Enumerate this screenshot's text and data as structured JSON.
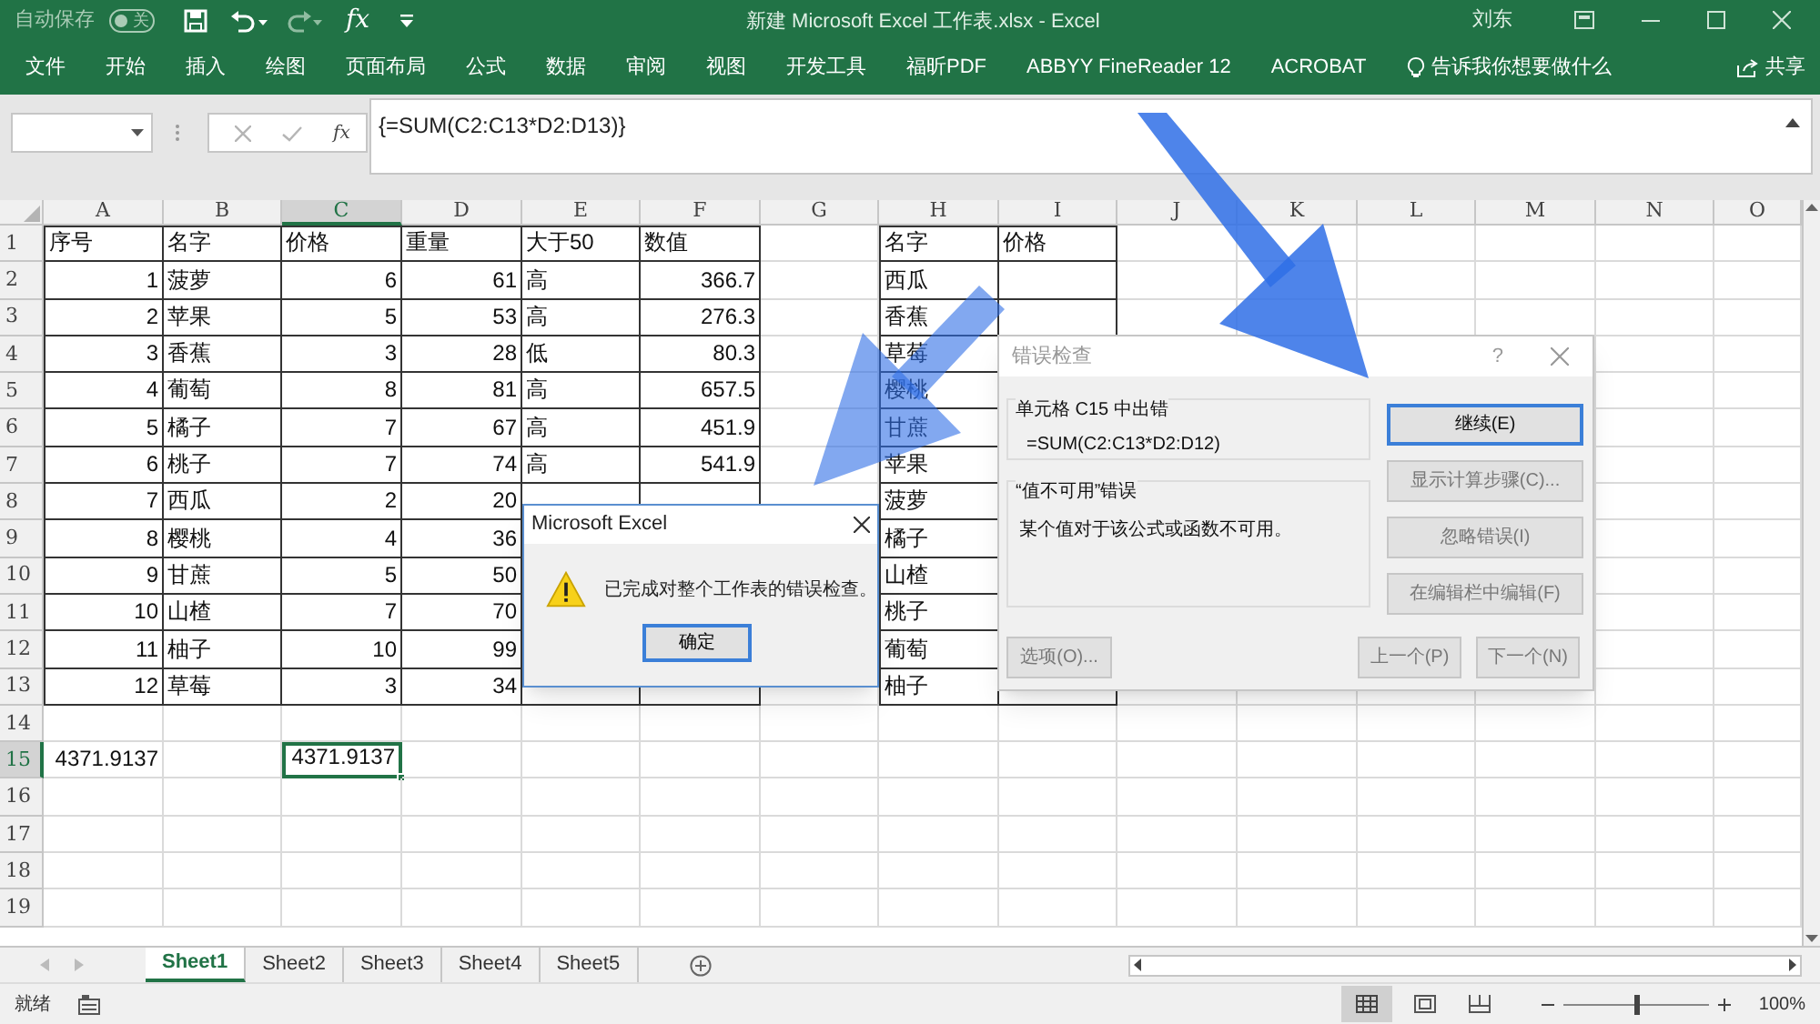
{
  "title_bar": {
    "autosave_label": "自动保存",
    "autosave_switch": "关",
    "autosave_on": false,
    "fx": "fx",
    "title": "新建 Microsoft Excel 工作表.xlsx  -  Excel",
    "user": "刘东"
  },
  "ribbon_tabs": [
    "文件",
    "开始",
    "插入",
    "绘图",
    "页面布局",
    "公式",
    "数据",
    "审阅",
    "视图",
    "开发工具",
    "福昕PDF",
    "ABBYY FineReader 12",
    "ACROBAT"
  ],
  "tell_me": "告诉我你想要做什么",
  "share": "共享",
  "formula_bar": {
    "fx": "fx",
    "formula": "{=SUM(C2:C13*D2:D13)}"
  },
  "columns": [
    {
      "label": "A",
      "selected": false
    },
    {
      "label": "B",
      "selected": false
    },
    {
      "label": "C",
      "selected": true
    },
    {
      "label": "D",
      "selected": false
    },
    {
      "label": "E",
      "selected": false
    },
    {
      "label": "F",
      "selected": false
    },
    {
      "label": "G",
      "selected": false
    },
    {
      "label": "H",
      "selected": false
    },
    {
      "label": "I",
      "selected": false
    },
    {
      "label": "J",
      "selected": false
    },
    {
      "label": "K",
      "selected": false
    },
    {
      "label": "L",
      "selected": false
    },
    {
      "label": "M",
      "selected": false
    },
    {
      "label": "N",
      "selected": false
    },
    {
      "label": "O",
      "selected": false
    }
  ],
  "rows": [
    {
      "label": "1",
      "selected": false,
      "cells": {
        "A": {
          "text": "序号",
          "kind": "text",
          "selected": false
        },
        "B": {
          "text": "名字",
          "kind": "text",
          "selected": false
        },
        "C": {
          "text": "价格",
          "kind": "text",
          "selected": false
        },
        "D": {
          "text": "重量",
          "kind": "text",
          "selected": false
        },
        "E": {
          "text": "大于50",
          "kind": "text",
          "selected": false
        },
        "F": {
          "text": "数值",
          "kind": "text",
          "selected": false
        },
        "H": {
          "text": "名字",
          "kind": "text",
          "selected": false
        },
        "I": {
          "text": "价格",
          "kind": "text",
          "selected": false
        }
      }
    },
    {
      "label": "2",
      "selected": false,
      "cells": {
        "A": {
          "text": "1",
          "kind": "number",
          "selected": false
        },
        "B": {
          "text": "菠萝",
          "kind": "text",
          "selected": false
        },
        "C": {
          "text": "6",
          "kind": "number",
          "selected": false
        },
        "D": {
          "text": "61",
          "kind": "number",
          "selected": false
        },
        "E": {
          "text": "高",
          "kind": "text",
          "selected": false
        },
        "F": {
          "text": "366.7",
          "kind": "number",
          "selected": false
        },
        "H": {
          "text": "西瓜",
          "kind": "text",
          "selected": false
        }
      }
    },
    {
      "label": "3",
      "selected": false,
      "cells": {
        "A": {
          "text": "2",
          "kind": "number",
          "selected": false
        },
        "B": {
          "text": "苹果",
          "kind": "text",
          "selected": false
        },
        "C": {
          "text": "5",
          "kind": "number",
          "selected": false
        },
        "D": {
          "text": "53",
          "kind": "number",
          "selected": false
        },
        "E": {
          "text": "高",
          "kind": "text",
          "selected": false
        },
        "F": {
          "text": "276.3",
          "kind": "number",
          "selected": false
        },
        "H": {
          "text": "香蕉",
          "kind": "text",
          "selected": false
        }
      }
    },
    {
      "label": "4",
      "selected": false,
      "cells": {
        "A": {
          "text": "3",
          "kind": "number",
          "selected": false
        },
        "B": {
          "text": "香蕉",
          "kind": "text",
          "selected": false
        },
        "C": {
          "text": "3",
          "kind": "number",
          "selected": false
        },
        "D": {
          "text": "28",
          "kind": "number",
          "selected": false
        },
        "E": {
          "text": "低",
          "kind": "text",
          "selected": false
        },
        "F": {
          "text": "80.3",
          "kind": "number",
          "selected": false
        },
        "H": {
          "text": "草莓",
          "kind": "text",
          "selected": false
        }
      }
    },
    {
      "label": "5",
      "selected": false,
      "cells": {
        "A": {
          "text": "4",
          "kind": "number",
          "selected": false
        },
        "B": {
          "text": "葡萄",
          "kind": "text",
          "selected": false
        },
        "C": {
          "text": "8",
          "kind": "number",
          "selected": false
        },
        "D": {
          "text": "81",
          "kind": "number",
          "selected": false
        },
        "E": {
          "text": "高",
          "kind": "text",
          "selected": false
        },
        "F": {
          "text": "657.5",
          "kind": "number",
          "selected": false
        },
        "H": {
          "text": "樱桃",
          "kind": "text",
          "selected": false
        }
      }
    },
    {
      "label": "6",
      "selected": false,
      "cells": {
        "A": {
          "text": "5",
          "kind": "number",
          "selected": false
        },
        "B": {
          "text": "橘子",
          "kind": "text",
          "selected": false
        },
        "C": {
          "text": "7",
          "kind": "number",
          "selected": false
        },
        "D": {
          "text": "67",
          "kind": "number",
          "selected": false
        },
        "E": {
          "text": "高",
          "kind": "text",
          "selected": false
        },
        "F": {
          "text": "451.9",
          "kind": "number",
          "selected": false
        },
        "H": {
          "text": "甘蔗",
          "kind": "text",
          "selected": false
        }
      }
    },
    {
      "label": "7",
      "selected": false,
      "cells": {
        "A": {
          "text": "6",
          "kind": "number",
          "selected": false
        },
        "B": {
          "text": "桃子",
          "kind": "text",
          "selected": false
        },
        "C": {
          "text": "7",
          "kind": "number",
          "selected": false
        },
        "D": {
          "text": "74",
          "kind": "number",
          "selected": false
        },
        "E": {
          "text": "高",
          "kind": "text",
          "selected": false
        },
        "F": {
          "text": "541.9",
          "kind": "number",
          "selected": false
        },
        "H": {
          "text": "苹果",
          "kind": "text",
          "selected": false
        }
      }
    },
    {
      "label": "8",
      "selected": false,
      "cells": {
        "A": {
          "text": "7",
          "kind": "number",
          "selected": false
        },
        "B": {
          "text": "西瓜",
          "kind": "text",
          "selected": false
        },
        "C": {
          "text": "2",
          "kind": "number",
          "selected": false
        },
        "D": {
          "text": "20",
          "kind": "number",
          "selected": false
        },
        "H": {
          "text": "菠萝",
          "kind": "text",
          "selected": false
        }
      }
    },
    {
      "label": "9",
      "selected": false,
      "cells": {
        "A": {
          "text": "8",
          "kind": "number",
          "selected": false
        },
        "B": {
          "text": "樱桃",
          "kind": "text",
          "selected": false
        },
        "C": {
          "text": "4",
          "kind": "number",
          "selected": false
        },
        "D": {
          "text": "36",
          "kind": "number",
          "selected": false
        },
        "H": {
          "text": "橘子",
          "kind": "text",
          "selected": false
        }
      }
    },
    {
      "label": "10",
      "selected": false,
      "cells": {
        "A": {
          "text": "9",
          "kind": "number",
          "selected": false
        },
        "B": {
          "text": "甘蔗",
          "kind": "text",
          "selected": false
        },
        "C": {
          "text": "5",
          "kind": "number",
          "selected": false
        },
        "D": {
          "text": "50",
          "kind": "number",
          "selected": false
        },
        "H": {
          "text": "山楂",
          "kind": "text",
          "selected": false
        }
      }
    },
    {
      "label": "11",
      "selected": false,
      "cells": {
        "A": {
          "text": "10",
          "kind": "number",
          "selected": false
        },
        "B": {
          "text": "山楂",
          "kind": "text",
          "selected": false
        },
        "C": {
          "text": "7",
          "kind": "number",
          "selected": false
        },
        "D": {
          "text": "70",
          "kind": "number",
          "selected": false
        },
        "H": {
          "text": "桃子",
          "kind": "text",
          "selected": false
        }
      }
    },
    {
      "label": "12",
      "selected": false,
      "cells": {
        "A": {
          "text": "11",
          "kind": "number",
          "selected": false
        },
        "B": {
          "text": "柚子",
          "kind": "text",
          "selected": false
        },
        "C": {
          "text": "10",
          "kind": "number",
          "selected": false
        },
        "D": {
          "text": "99",
          "kind": "number",
          "selected": false
        },
        "H": {
          "text": "葡萄",
          "kind": "text",
          "selected": false
        }
      }
    },
    {
      "label": "13",
      "selected": false,
      "cells": {
        "A": {
          "text": "12",
          "kind": "number",
          "selected": false
        },
        "B": {
          "text": "草莓",
          "kind": "text",
          "selected": false
        },
        "C": {
          "text": "3",
          "kind": "number",
          "selected": false
        },
        "D": {
          "text": "34",
          "kind": "number",
          "selected": false
        },
        "H": {
          "text": "柚子",
          "kind": "text",
          "selected": false
        }
      }
    },
    {
      "label": "14",
      "selected": false
    },
    {
      "label": "15",
      "selected": true,
      "cells": {
        "A": {
          "text": "4371.9137",
          "kind": "number",
          "selected": false
        },
        "C": {
          "text": "4371.9137",
          "kind": "number",
          "selected": true
        }
      }
    },
    {
      "label": "16",
      "selected": false
    },
    {
      "label": "17",
      "selected": false
    },
    {
      "label": "18",
      "selected": false
    },
    {
      "label": "19",
      "selected": false
    }
  ],
  "sheet_tabs": [
    {
      "label": "Sheet1",
      "selected": true
    },
    {
      "label": "Sheet2",
      "selected": false
    },
    {
      "label": "Sheet3",
      "selected": false
    },
    {
      "label": "Sheet4",
      "selected": false
    },
    {
      "label": "Sheet5",
      "selected": false
    }
  ],
  "status_bar": {
    "status": "就绪",
    "zoom_slider": {
      "level": 0.5
    },
    "zoom": "100%"
  },
  "message_dialog": {
    "title": "Microsoft Excel",
    "message": "已完成对整个工作表的错误检查。",
    "button": "确定"
  },
  "error_dialog": {
    "title": "错误检查",
    "help": "?",
    "cell_error": "单元格 C15 中出错",
    "formula": "=SUM(C2:C13*D2:D12)",
    "error_type": "“值不可用”错误",
    "description": "某个值对于该公式或函数不可用。",
    "side_buttons": [
      {
        "label": "继续(E)",
        "focused": true
      },
      {
        "label": "显示计算步骤(C)...",
        "focused": false
      },
      {
        "label": "忽略错误(I)",
        "focused": false
      },
      {
        "label": "在编辑栏中编辑(F)",
        "focused": false
      }
    ],
    "options_button": "选项(O)...",
    "nav_buttons": [
      "上一个(P)",
      "下一个(N)"
    ]
  }
}
